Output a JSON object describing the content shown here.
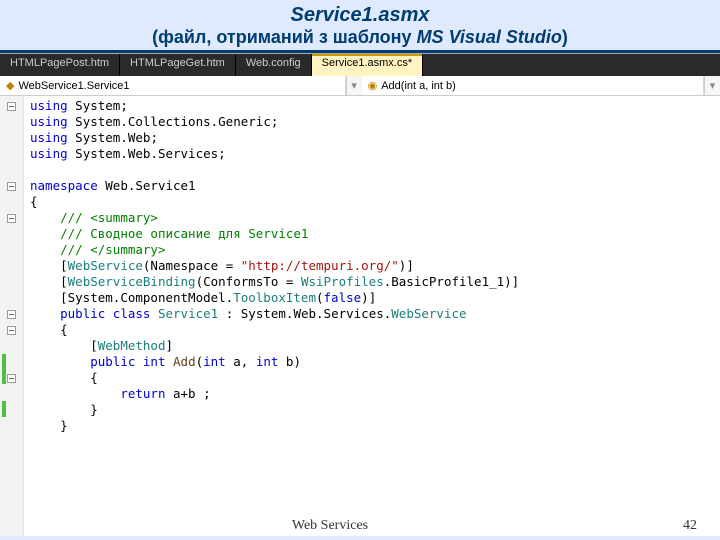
{
  "slide": {
    "title1": "Service1.asmx",
    "title2_pre": "(файл, отриманий з шаблону ",
    "title2_em": "MS Visual Studio",
    "title2_post": ")"
  },
  "tabs": [
    {
      "label": "HTMLPagePost.htm"
    },
    {
      "label": "HTMLPageGet.htm"
    },
    {
      "label": "Web.config"
    },
    {
      "label": "Service1.asmx.cs*"
    }
  ],
  "nav": {
    "left": "WebService1.Service1",
    "right": "Add(int a, int b)"
  },
  "code": {
    "u1": "using",
    "u2": "using",
    "u3": "using",
    "u4": "using",
    "ns1": "System",
    "ns2": "System.Collections.Generic",
    "ns3": "System.Web",
    "ns4": "System.Web.Services",
    "ns_kw": "namespace",
    "ns_name": "Web.Service1",
    "brace_o": "{",
    "brace_c": "}",
    "c1": "/// <summary>",
    "c2": "/// Сводное описание для Service1",
    "c3": "/// </summary>",
    "attr_ws_o": "[",
    "attr_ws_t": "WebService",
    "attr_ws_rest": "(Namespace = ",
    "attr_ws_str": "\"http://tempuri.org/\"",
    "attr_ws_end": ")]",
    "attr_wsb_o": "[",
    "attr_wsb_t": "WebServiceBinding",
    "attr_wsb_rest": "(ConformsTo = ",
    "attr_wsb_v": "WsiProfiles",
    "attr_wsb_rest2": ".BasicProfile1_1)]",
    "attr_tb": "[System.ComponentModel.",
    "attr_tb_t": "ToolboxItem",
    "attr_tb_rest": "(",
    "attr_tb_false": "false",
    "attr_tb_end": ")]",
    "pub": "public",
    "cls": "class",
    "cls_name": "Service1",
    "colon": " : System.Web.Services.",
    "base": "WebService",
    "wm_o": "[",
    "wm_t": "WebMethod",
    "wm_c": "]",
    "pub2": "public",
    "int": "int",
    "fname": "Add",
    "sig": "(",
    "int2": "int",
    "ap": " a, ",
    "int3": "int",
    "bp": " b)",
    "ret": "return",
    "expr": " a+b ;",
    "semi": ";"
  },
  "footer": {
    "center": "Web Services",
    "page": "42"
  }
}
